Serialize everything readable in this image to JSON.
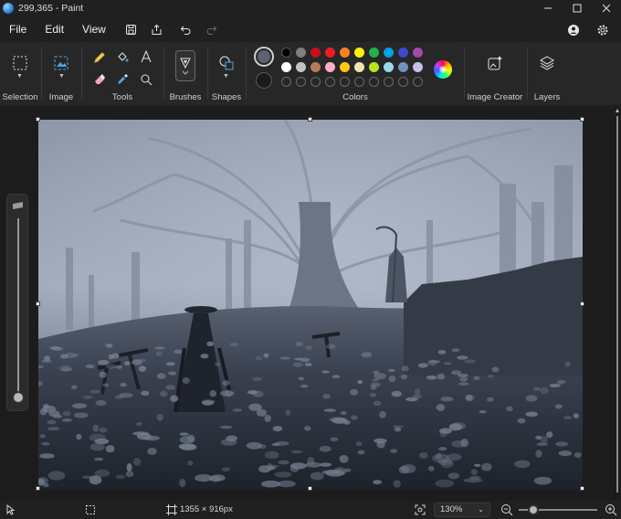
{
  "window": {
    "title": "299,365 - Paint"
  },
  "menu": {
    "file": "File",
    "edit": "Edit",
    "view": "View"
  },
  "ribbon": {
    "selection": "Selection",
    "image": "Image",
    "tools": "Tools",
    "brushes": "Brushes",
    "shapes": "Shapes",
    "colors": "Colors",
    "image_creator": "Image Creator",
    "layers": "Layers"
  },
  "palette": {
    "primary": "#5b6270",
    "secondary": "#1b1b1b",
    "row1": [
      "#000000",
      "#7f7f7f",
      "#c3101d",
      "#ed1c24",
      "#ff7f27",
      "#fff200",
      "#22b14c",
      "#00a2e8",
      "#3f48cc",
      "#a349a4"
    ],
    "row2": [
      "#ffffff",
      "#c3c3c3",
      "#b97a57",
      "#ffaec9",
      "#ffc90e",
      "#efe4b0",
      "#b5e61d",
      "#99d9ea",
      "#7092be",
      "#c8bfe7"
    ]
  },
  "status": {
    "dimensions": "1355 × 916px",
    "zoom": "130%"
  }
}
